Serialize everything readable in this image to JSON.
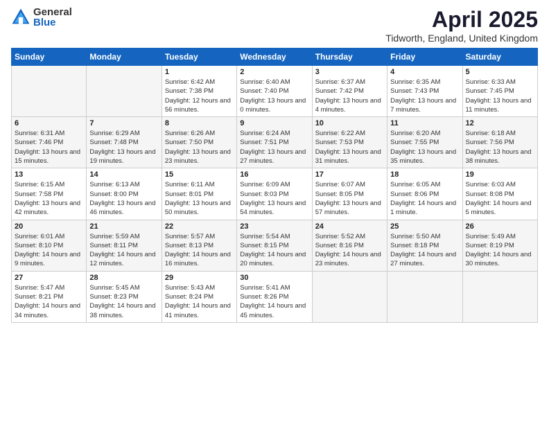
{
  "header": {
    "logo_general": "General",
    "logo_blue": "Blue",
    "title": "April 2025",
    "location": "Tidworth, England, United Kingdom"
  },
  "days": [
    "Sunday",
    "Monday",
    "Tuesday",
    "Wednesday",
    "Thursday",
    "Friday",
    "Saturday"
  ],
  "weeks": [
    [
      {
        "date": "",
        "sunrise": "",
        "sunset": "",
        "daylight": ""
      },
      {
        "date": "",
        "sunrise": "",
        "sunset": "",
        "daylight": ""
      },
      {
        "date": "1",
        "sunrise": "Sunrise: 6:42 AM",
        "sunset": "Sunset: 7:38 PM",
        "daylight": "Daylight: 12 hours and 56 minutes."
      },
      {
        "date": "2",
        "sunrise": "Sunrise: 6:40 AM",
        "sunset": "Sunset: 7:40 PM",
        "daylight": "Daylight: 13 hours and 0 minutes."
      },
      {
        "date": "3",
        "sunrise": "Sunrise: 6:37 AM",
        "sunset": "Sunset: 7:42 PM",
        "daylight": "Daylight: 13 hours and 4 minutes."
      },
      {
        "date": "4",
        "sunrise": "Sunrise: 6:35 AM",
        "sunset": "Sunset: 7:43 PM",
        "daylight": "Daylight: 13 hours and 7 minutes."
      },
      {
        "date": "5",
        "sunrise": "Sunrise: 6:33 AM",
        "sunset": "Sunset: 7:45 PM",
        "daylight": "Daylight: 13 hours and 11 minutes."
      }
    ],
    [
      {
        "date": "6",
        "sunrise": "Sunrise: 6:31 AM",
        "sunset": "Sunset: 7:46 PM",
        "daylight": "Daylight: 13 hours and 15 minutes."
      },
      {
        "date": "7",
        "sunrise": "Sunrise: 6:29 AM",
        "sunset": "Sunset: 7:48 PM",
        "daylight": "Daylight: 13 hours and 19 minutes."
      },
      {
        "date": "8",
        "sunrise": "Sunrise: 6:26 AM",
        "sunset": "Sunset: 7:50 PM",
        "daylight": "Daylight: 13 hours and 23 minutes."
      },
      {
        "date": "9",
        "sunrise": "Sunrise: 6:24 AM",
        "sunset": "Sunset: 7:51 PM",
        "daylight": "Daylight: 13 hours and 27 minutes."
      },
      {
        "date": "10",
        "sunrise": "Sunrise: 6:22 AM",
        "sunset": "Sunset: 7:53 PM",
        "daylight": "Daylight: 13 hours and 31 minutes."
      },
      {
        "date": "11",
        "sunrise": "Sunrise: 6:20 AM",
        "sunset": "Sunset: 7:55 PM",
        "daylight": "Daylight: 13 hours and 35 minutes."
      },
      {
        "date": "12",
        "sunrise": "Sunrise: 6:18 AM",
        "sunset": "Sunset: 7:56 PM",
        "daylight": "Daylight: 13 hours and 38 minutes."
      }
    ],
    [
      {
        "date": "13",
        "sunrise": "Sunrise: 6:15 AM",
        "sunset": "Sunset: 7:58 PM",
        "daylight": "Daylight: 13 hours and 42 minutes."
      },
      {
        "date": "14",
        "sunrise": "Sunrise: 6:13 AM",
        "sunset": "Sunset: 8:00 PM",
        "daylight": "Daylight: 13 hours and 46 minutes."
      },
      {
        "date": "15",
        "sunrise": "Sunrise: 6:11 AM",
        "sunset": "Sunset: 8:01 PM",
        "daylight": "Daylight: 13 hours and 50 minutes."
      },
      {
        "date": "16",
        "sunrise": "Sunrise: 6:09 AM",
        "sunset": "Sunset: 8:03 PM",
        "daylight": "Daylight: 13 hours and 54 minutes."
      },
      {
        "date": "17",
        "sunrise": "Sunrise: 6:07 AM",
        "sunset": "Sunset: 8:05 PM",
        "daylight": "Daylight: 13 hours and 57 minutes."
      },
      {
        "date": "18",
        "sunrise": "Sunrise: 6:05 AM",
        "sunset": "Sunset: 8:06 PM",
        "daylight": "Daylight: 14 hours and 1 minute."
      },
      {
        "date": "19",
        "sunrise": "Sunrise: 6:03 AM",
        "sunset": "Sunset: 8:08 PM",
        "daylight": "Daylight: 14 hours and 5 minutes."
      }
    ],
    [
      {
        "date": "20",
        "sunrise": "Sunrise: 6:01 AM",
        "sunset": "Sunset: 8:10 PM",
        "daylight": "Daylight: 14 hours and 9 minutes."
      },
      {
        "date": "21",
        "sunrise": "Sunrise: 5:59 AM",
        "sunset": "Sunset: 8:11 PM",
        "daylight": "Daylight: 14 hours and 12 minutes."
      },
      {
        "date": "22",
        "sunrise": "Sunrise: 5:57 AM",
        "sunset": "Sunset: 8:13 PM",
        "daylight": "Daylight: 14 hours and 16 minutes."
      },
      {
        "date": "23",
        "sunrise": "Sunrise: 5:54 AM",
        "sunset": "Sunset: 8:15 PM",
        "daylight": "Daylight: 14 hours and 20 minutes."
      },
      {
        "date": "24",
        "sunrise": "Sunrise: 5:52 AM",
        "sunset": "Sunset: 8:16 PM",
        "daylight": "Daylight: 14 hours and 23 minutes."
      },
      {
        "date": "25",
        "sunrise": "Sunrise: 5:50 AM",
        "sunset": "Sunset: 8:18 PM",
        "daylight": "Daylight: 14 hours and 27 minutes."
      },
      {
        "date": "26",
        "sunrise": "Sunrise: 5:49 AM",
        "sunset": "Sunset: 8:19 PM",
        "daylight": "Daylight: 14 hours and 30 minutes."
      }
    ],
    [
      {
        "date": "27",
        "sunrise": "Sunrise: 5:47 AM",
        "sunset": "Sunset: 8:21 PM",
        "daylight": "Daylight: 14 hours and 34 minutes."
      },
      {
        "date": "28",
        "sunrise": "Sunrise: 5:45 AM",
        "sunset": "Sunset: 8:23 PM",
        "daylight": "Daylight: 14 hours and 38 minutes."
      },
      {
        "date": "29",
        "sunrise": "Sunrise: 5:43 AM",
        "sunset": "Sunset: 8:24 PM",
        "daylight": "Daylight: 14 hours and 41 minutes."
      },
      {
        "date": "30",
        "sunrise": "Sunrise: 5:41 AM",
        "sunset": "Sunset: 8:26 PM",
        "daylight": "Daylight: 14 hours and 45 minutes."
      },
      {
        "date": "",
        "sunrise": "",
        "sunset": "",
        "daylight": ""
      },
      {
        "date": "",
        "sunrise": "",
        "sunset": "",
        "daylight": ""
      },
      {
        "date": "",
        "sunrise": "",
        "sunset": "",
        "daylight": ""
      }
    ]
  ]
}
